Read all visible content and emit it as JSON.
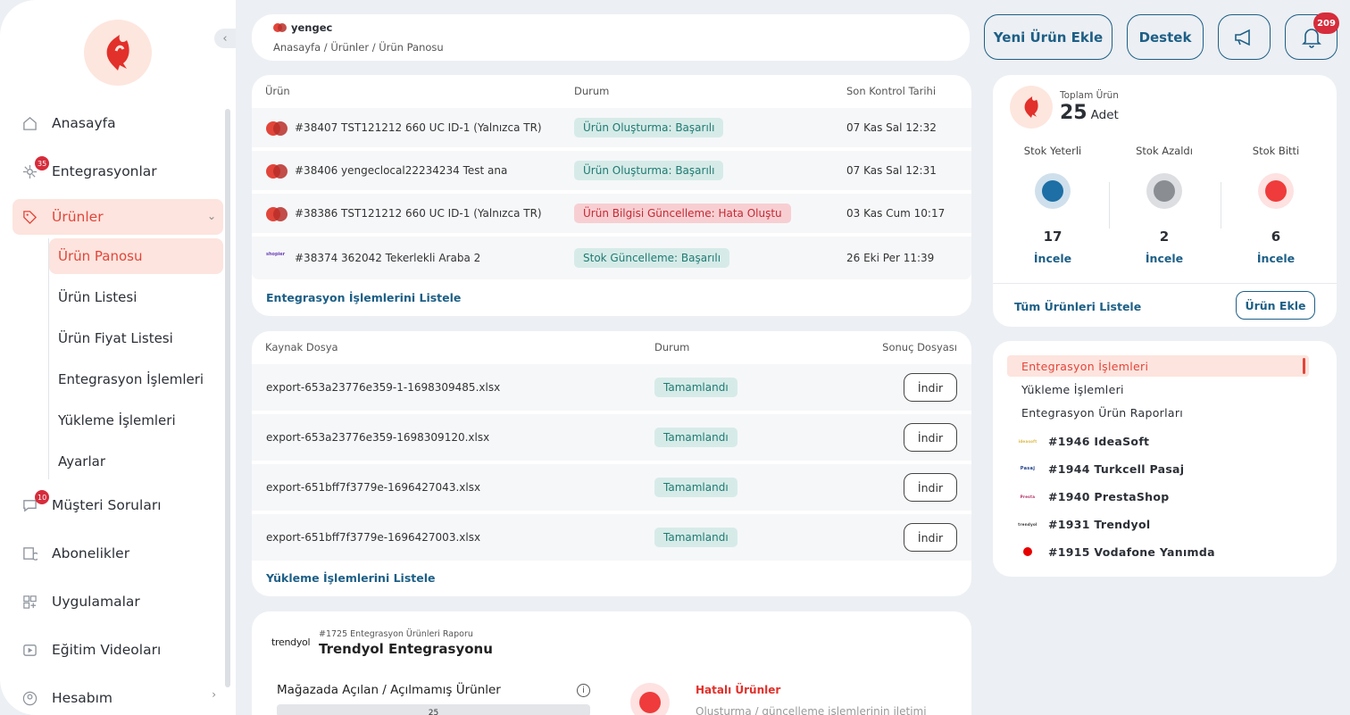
{
  "sidebar": {
    "items": [
      {
        "label": "Anasayfa",
        "icon": "home-icon"
      },
      {
        "label": "Entegrasyonlar",
        "icon": "integration-icon",
        "badge": "35"
      },
      {
        "label": "Ürünler",
        "icon": "tag-icon"
      },
      {
        "label": "Müşteri Soruları",
        "icon": "chat-icon",
        "badge": "10"
      },
      {
        "label": "Abonelikler",
        "icon": "subscription-icon"
      },
      {
        "label": "Uygulamalar",
        "icon": "apps-icon"
      },
      {
        "label": "Eğitim Videoları",
        "icon": "video-icon"
      },
      {
        "label": "Hesabım",
        "icon": "user-icon"
      }
    ],
    "sub_items": [
      "Ürün Panosu",
      "Ürün Listesi",
      "Ürün Fiyat Listesi",
      "Entegrasyon İşlemleri",
      "Yükleme İşlemleri",
      "Ayarlar"
    ]
  },
  "header": {
    "store": "yengec",
    "breadcrumb": "Anasayfa / Ürünler / Ürün Panosu",
    "new_product": "Yeni Ürün Ekle",
    "support": "Destek",
    "notif_count": "209"
  },
  "integrations_table": {
    "headers": [
      "Ürün",
      "Durum",
      "Son Kontrol Tarihi"
    ],
    "rows": [
      {
        "product": "#38407 TST121212 660 UC ID-1 (Yalnızca TR)",
        "status": "Ürün Oluşturma: Başarılı",
        "date": "07 Kas Sal 12:32",
        "logo": "yengec"
      },
      {
        "product": "#38406 yengeclocal22234234 Test ana",
        "status": "Ürün Oluşturma: Başarılı",
        "date": "07 Kas Sal 12:31",
        "logo": "yengec"
      },
      {
        "product": "#38386 TST121212 660 UC ID-1 (Yalnızca TR)",
        "status": "Ürün Bilgisi Güncelleme: Hata Oluştu",
        "date": "03 Kas Cum 10:17",
        "logo": "yengec"
      },
      {
        "product": "#38374 362042 Tekerlekli Araba 2",
        "status": "Stok Güncelleme: Başarılı",
        "date": "26 Eki Per 11:39",
        "logo": "shopier"
      }
    ],
    "link": "Entegrasyon İşlemlerini Listele"
  },
  "uploads_table": {
    "headers": [
      "Kaynak Dosya",
      "Durum",
      "Sonuç Dosyası"
    ],
    "rows": [
      {
        "file": "export-653a23776e359-1-1698309485.xlsx",
        "status": "Tamamlandı",
        "action": "İndir"
      },
      {
        "file": "export-653a23776e359-1698309120.xlsx",
        "status": "Tamamlandı",
        "action": "İndir"
      },
      {
        "file": "export-651bff7f3779e-1696427043.xlsx",
        "status": "Tamamlandı",
        "action": "İndir"
      },
      {
        "file": "export-651bff7f3779e-1696427003.xlsx",
        "status": "Tamamlandı",
        "action": "İndir"
      }
    ],
    "link": "Yükleme İşlemlerini Listele"
  },
  "report": {
    "logo": "trendyol",
    "subtitle": "#1725 Entegrasyon Ürünleri Raporu",
    "title": "Trendyol Entegrasyonu",
    "section": "Mağazada Açılan / Açılmamış Ürünler",
    "bar_value": "25",
    "error_label": "Hatalı Ürünler",
    "error_desc": "Oluşturma / güncelleme işlemlerinin iletimi"
  },
  "stock": {
    "total_label": "Toplam Ürün",
    "total_value": "25",
    "total_unit": "Adet",
    "items": [
      {
        "label": "Stok Yeterli",
        "count": "17",
        "action": "İncele",
        "color": "#1d6fa5",
        "ring": "#cfe0ec"
      },
      {
        "label": "Stok Azaldı",
        "count": "2",
        "action": "İncele",
        "color": "#8a8d92",
        "ring": "#dcdee1"
      },
      {
        "label": "Stok Bitti",
        "count": "6",
        "action": "İncele",
        "color": "#ef3b3b",
        "ring": "#fde2e1"
      }
    ],
    "list_all": "Tüm Ürünleri Listele",
    "add": "Ürün Ekle"
  },
  "side_menu": {
    "items": [
      "Entegrasyon İşlemleri",
      "Yükleme İşlemleri",
      "Entegrasyon Ürün Raporları"
    ],
    "reports": [
      {
        "label": "#1946 IdeaSoft",
        "logo": "ideasoft"
      },
      {
        "label": "#1944 Turkcell Pasaj",
        "logo": "pasaj"
      },
      {
        "label": "#1940 PrestaShop",
        "logo": "prestashop"
      },
      {
        "label": "#1931 Trendyol",
        "logo": "trendyol"
      },
      {
        "label": "#1915 Vodafone Yanımda",
        "logo": "vodafone"
      }
    ]
  },
  "colors": {
    "accent": "#e2453a",
    "primary": "#1d5f86",
    "success_bg": "#d6ebe8",
    "error_bg": "#f7cfd2"
  }
}
